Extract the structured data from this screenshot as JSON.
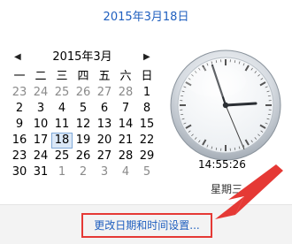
{
  "header": {
    "full_date": "2015年3月18日"
  },
  "calendar": {
    "month_label": "2015年3月",
    "prev_symbol": "◀",
    "next_symbol": "▶",
    "weekdays": [
      "一",
      "二",
      "三",
      "四",
      "五",
      "六",
      "日"
    ],
    "weeks": [
      [
        {
          "day": "23",
          "current": false
        },
        {
          "day": "24",
          "current": false
        },
        {
          "day": "25",
          "current": false
        },
        {
          "day": "26",
          "current": false
        },
        {
          "day": "27",
          "current": false
        },
        {
          "day": "28",
          "current": false
        },
        {
          "day": "1",
          "current": true
        }
      ],
      [
        {
          "day": "2",
          "current": true
        },
        {
          "day": "3",
          "current": true
        },
        {
          "day": "4",
          "current": true
        },
        {
          "day": "5",
          "current": true
        },
        {
          "day": "6",
          "current": true
        },
        {
          "day": "7",
          "current": true
        },
        {
          "day": "8",
          "current": true
        }
      ],
      [
        {
          "day": "9",
          "current": true
        },
        {
          "day": "10",
          "current": true
        },
        {
          "day": "11",
          "current": true
        },
        {
          "day": "12",
          "current": true
        },
        {
          "day": "13",
          "current": true
        },
        {
          "day": "14",
          "current": true
        },
        {
          "day": "15",
          "current": true
        }
      ],
      [
        {
          "day": "16",
          "current": true
        },
        {
          "day": "17",
          "current": true
        },
        {
          "day": "18",
          "current": true,
          "today": true
        },
        {
          "day": "19",
          "current": true
        },
        {
          "day": "20",
          "current": true
        },
        {
          "day": "21",
          "current": true
        },
        {
          "day": "22",
          "current": true
        }
      ],
      [
        {
          "day": "23",
          "current": true
        },
        {
          "day": "24",
          "current": true
        },
        {
          "day": "25",
          "current": true
        },
        {
          "day": "26",
          "current": true
        },
        {
          "day": "27",
          "current": true
        },
        {
          "day": "28",
          "current": true
        },
        {
          "day": "29",
          "current": true
        }
      ],
      [
        {
          "day": "30",
          "current": true
        },
        {
          "day": "31",
          "current": true
        },
        {
          "day": "1",
          "current": false
        },
        {
          "day": "2",
          "current": false
        },
        {
          "day": "3",
          "current": false
        },
        {
          "day": "4",
          "current": false
        },
        {
          "day": "5",
          "current": false
        }
      ]
    ]
  },
  "clock": {
    "time": "14:55:26",
    "day_partial": "星期三"
  },
  "footer": {
    "change_link": "更改日期和时间设置..."
  },
  "colors": {
    "link_blue": "#1f5fbf",
    "highlight_red": "#e53935"
  },
  "icons": {
    "prev": "chevron-left-icon",
    "next": "chevron-right-icon"
  }
}
